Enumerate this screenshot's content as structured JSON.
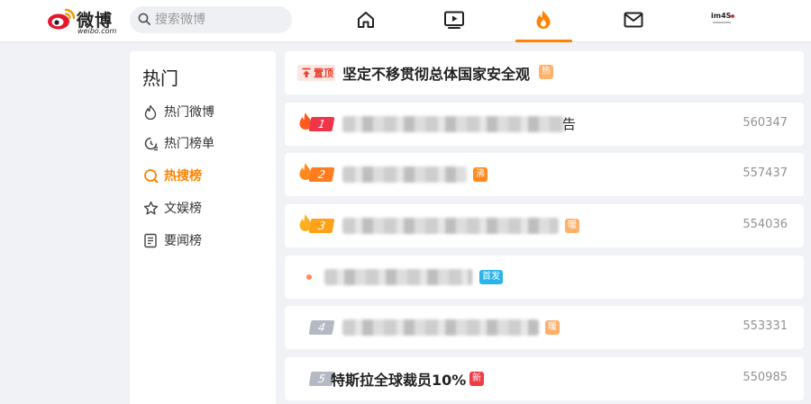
{
  "header": {
    "brand": "微博",
    "brand_sub": "weibo.com",
    "search_placeholder": "搜索微博",
    "avatar_text": "im4S"
  },
  "colors": {
    "accent": "#ff8200",
    "hot_red": "#e83d2c",
    "new_red": "#f03c46",
    "warm_orange": "#ffb06b",
    "first_blue": "#2ab5e8"
  },
  "sidebar": {
    "title": "热门",
    "items": [
      {
        "label": "热门微博",
        "icon": "flame-outline-icon",
        "active": false
      },
      {
        "label": "热门榜单",
        "icon": "clock-list-icon",
        "active": false
      },
      {
        "label": "热搜榜",
        "icon": "search-circle-icon",
        "active": true
      },
      {
        "label": "文娱榜",
        "icon": "star-icon",
        "active": false
      },
      {
        "label": "要闻榜",
        "icon": "news-icon",
        "active": false
      }
    ]
  },
  "feed": {
    "pinned": {
      "tag": "置顶",
      "title": "坚定不移贯彻总体国家安全观",
      "badge": "热"
    },
    "items": [
      {
        "rank": "1",
        "title_visible": "告",
        "badge": "",
        "count": "560347"
      },
      {
        "rank": "2",
        "title_visible": "",
        "badge": "沸",
        "count": "557437"
      },
      {
        "rank": "3",
        "title_visible": "",
        "badge": "暖",
        "count": "554036"
      },
      {
        "rank": "",
        "title_visible": "",
        "badge": "首发",
        "count": ""
      },
      {
        "rank": "4",
        "title_visible": "",
        "badge": "暖",
        "count": "553331"
      },
      {
        "rank": "5",
        "title_visible": "特斯拉全球裁员10%",
        "badge": "新",
        "count": "550985"
      }
    ]
  }
}
